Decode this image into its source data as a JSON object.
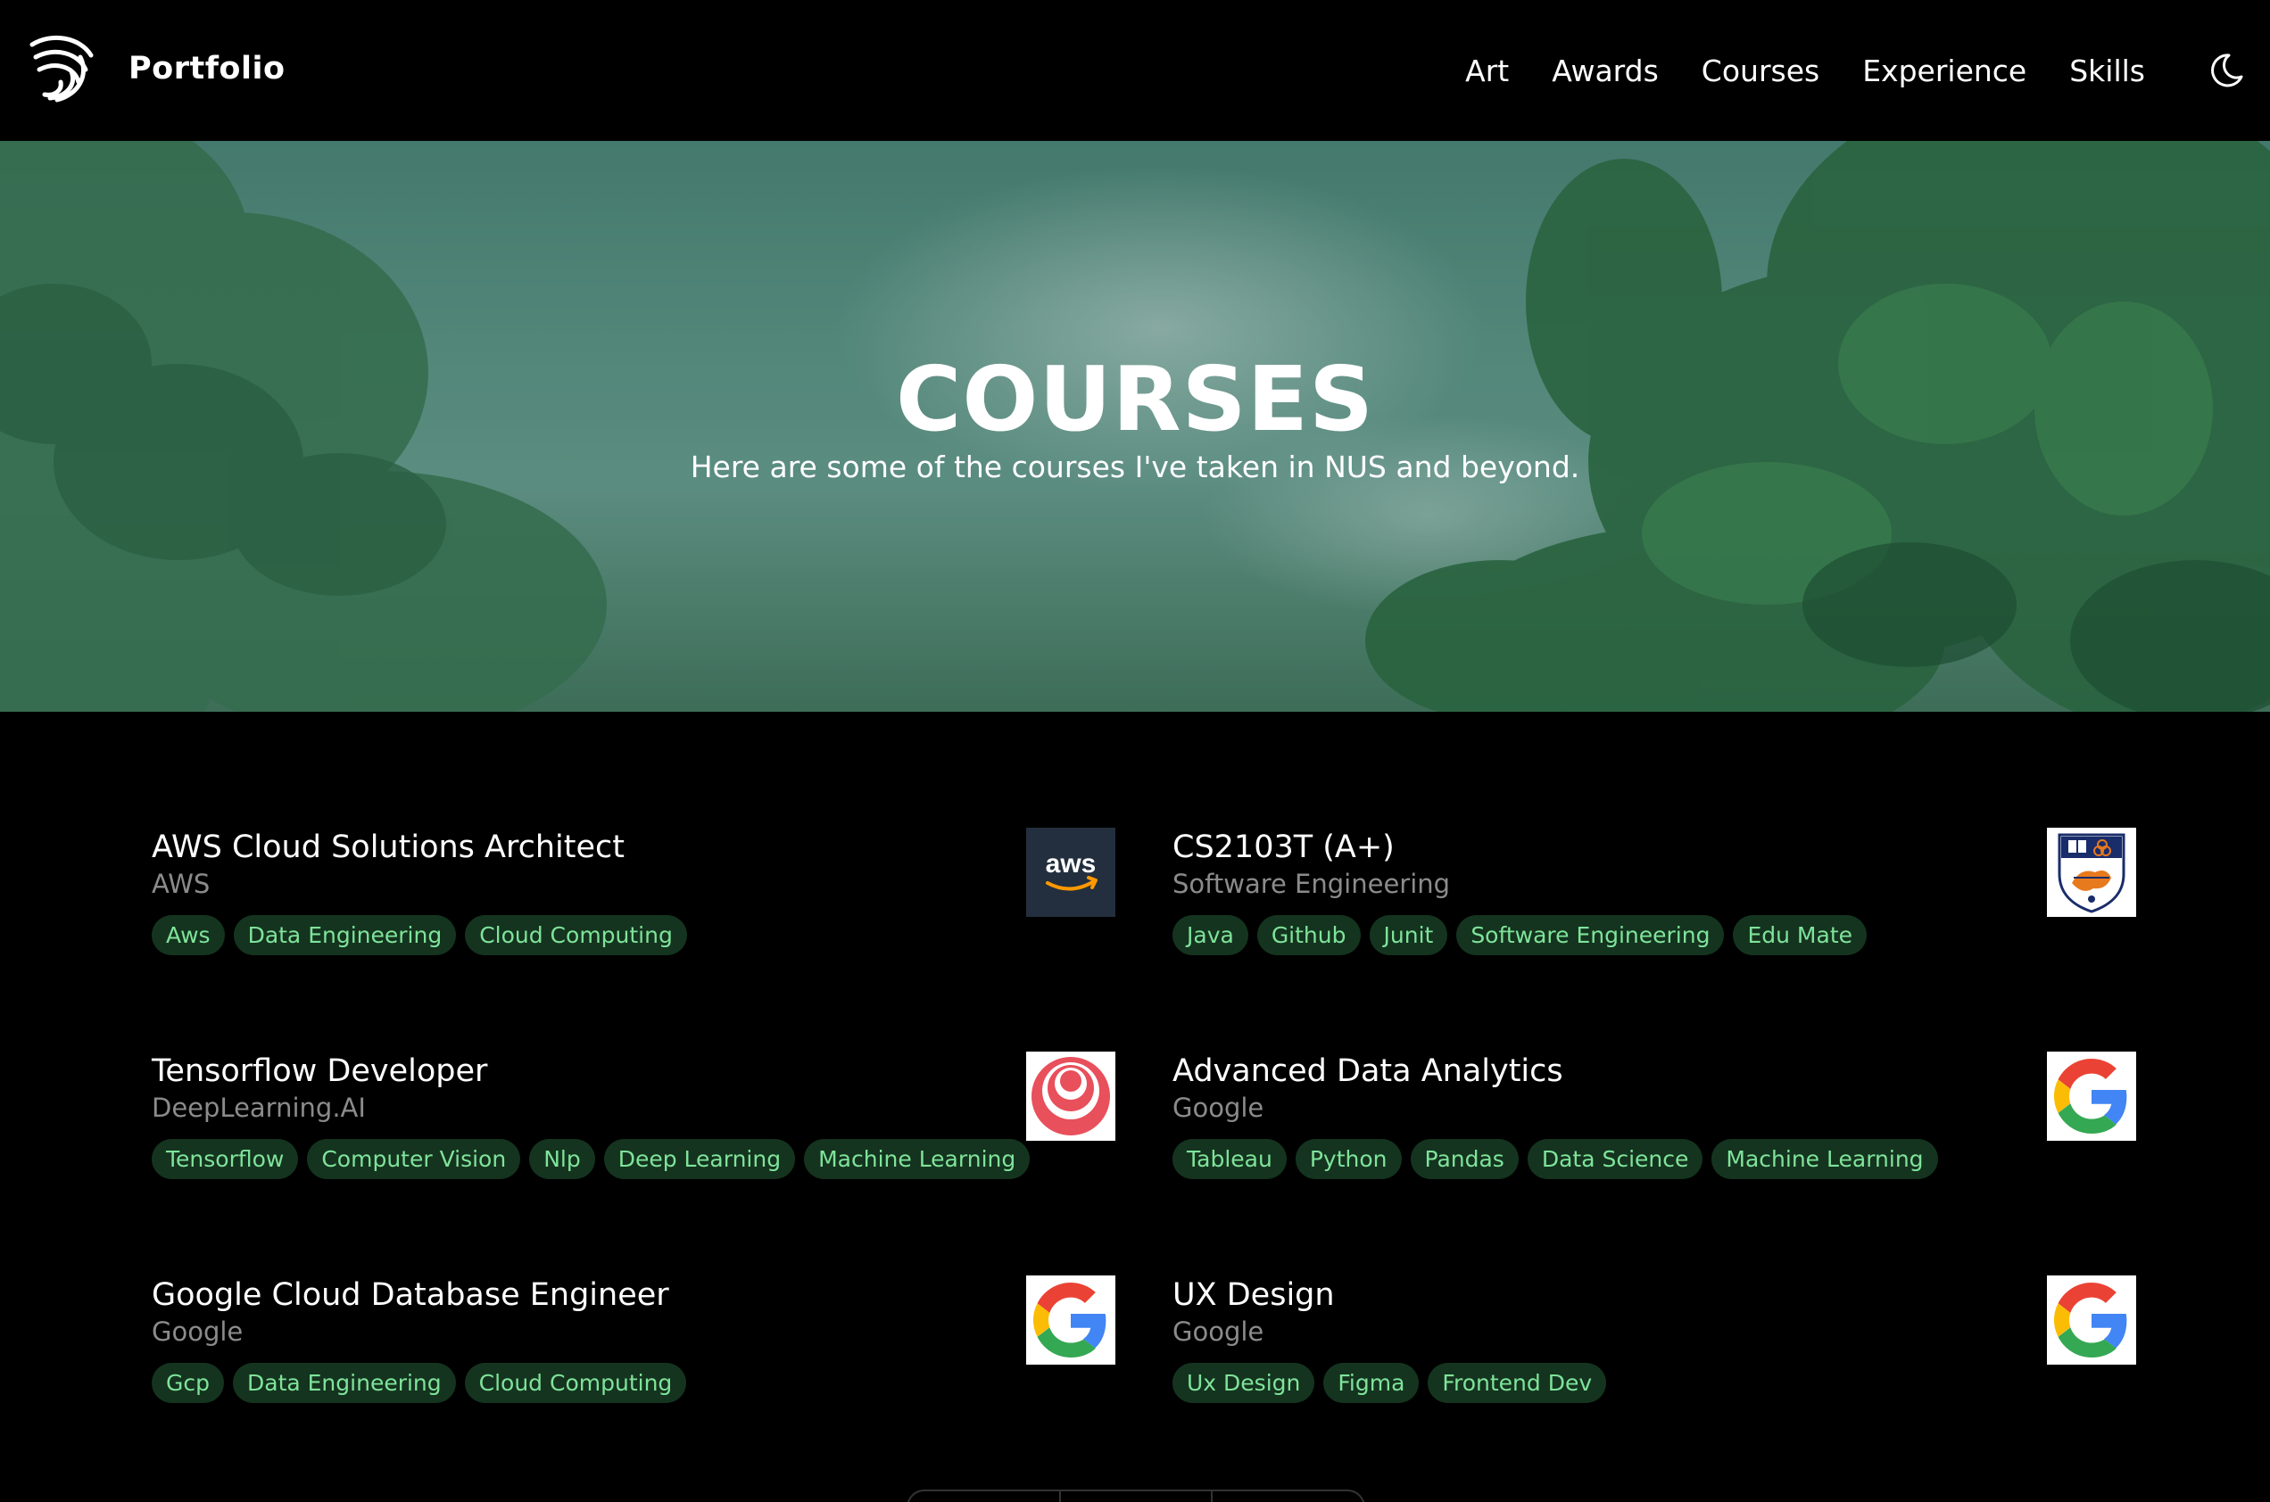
{
  "navbar": {
    "brand": "Portfolio",
    "links": [
      "Art",
      "Awards",
      "Courses",
      "Experience",
      "Skills"
    ],
    "theme_icon": "moon-icon"
  },
  "hero": {
    "title": "COURSES",
    "subtitle": "Here are some of the courses I've taken in NUS and beyond."
  },
  "courses": [
    {
      "title": "AWS Cloud Solutions Architect",
      "org": "AWS",
      "tags": [
        "Aws",
        "Data Engineering",
        "Cloud Computing"
      ],
      "logo": "aws-logo",
      "logo_text": "aws"
    },
    {
      "title": "CS2103T (A+)",
      "org": "Software Engineering",
      "tags": [
        "Java",
        "Github",
        "Junit",
        "Software Engineering",
        "Edu Mate"
      ],
      "logo": "nus-crest-logo"
    },
    {
      "title": "Tensorflow Developer",
      "org": "DeepLearning.AI",
      "tags": [
        "Tensorflow",
        "Computer Vision",
        "Nlp",
        "Deep Learning",
        "Machine Learning"
      ],
      "logo": "deeplearning-ai-logo"
    },
    {
      "title": "Advanced Data Analytics",
      "org": "Google",
      "tags": [
        "Tableau",
        "Python",
        "Pandas",
        "Data Science",
        "Machine Learning"
      ],
      "logo": "google-logo"
    },
    {
      "title": "Google Cloud Database Engineer",
      "org": "Google",
      "tags": [
        "Gcp",
        "Data Engineering",
        "Cloud Computing"
      ],
      "logo": "google-logo"
    },
    {
      "title": "UX Design",
      "org": "Google",
      "tags": [
        "Ux Design",
        "Figma",
        "Frontend Dev"
      ],
      "logo": "google-logo"
    }
  ],
  "colors": {
    "background": "#000000",
    "tag_bg": "#14341f",
    "tag_text": "#7fe39a",
    "muted_text": "#8b8b8b",
    "aws_bg": "#232f3e",
    "aws_arrow": "#ff9900",
    "dl_red": "#e8505b"
  }
}
